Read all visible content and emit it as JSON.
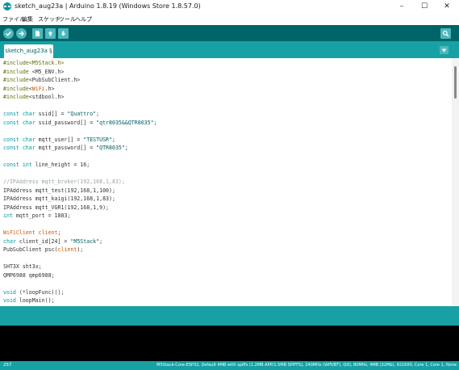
{
  "window": {
    "title": "sketch_aug23a | Arduino 1.8.19 (Windows Store 1.8.57.0)",
    "minimize": "–",
    "maximize": "☐",
    "close": "✕"
  },
  "menu": [
    "ファイル",
    "編集",
    "スケッチ",
    "ツール",
    "ヘルプ"
  ],
  "tab": {
    "label": "sketch_aug23a §"
  },
  "code": [
    [
      [
        "pre",
        "#include<M5Stack.h>"
      ]
    ],
    [
      [
        "pre",
        "#include "
      ],
      [
        "id",
        "<M5_ENV.h>"
      ]
    ],
    [
      [
        "pre",
        "#include"
      ],
      [
        "id",
        "<PubSubClient.h>"
      ]
    ],
    [
      [
        "pre",
        "#include"
      ],
      [
        "id",
        "<"
      ],
      [
        "cls",
        "WiFi"
      ],
      [
        "id",
        ".h>"
      ]
    ],
    [
      [
        "pre",
        "#include"
      ],
      [
        "id",
        "<stdbool.h>"
      ]
    ],
    [],
    [
      [
        "kw",
        "const char"
      ],
      [
        "id",
        " ssid[] = "
      ],
      [
        "str",
        "\"Quattro\""
      ],
      [
        "id",
        ";"
      ]
    ],
    [
      [
        "kw",
        "const char"
      ],
      [
        "id",
        " ssid_password[] = "
      ],
      [
        "str",
        "\"qtr8035&&QTR8035\""
      ],
      [
        "id",
        ";"
      ]
    ],
    [],
    [
      [
        "kw",
        "const char"
      ],
      [
        "id",
        " mqtt_user[] = "
      ],
      [
        "str",
        "\"TESTUSR\""
      ],
      [
        "id",
        ";"
      ]
    ],
    [
      [
        "kw",
        "const char"
      ],
      [
        "id",
        " mqtt_password[] = "
      ],
      [
        "str",
        "\"QTR8035\""
      ],
      [
        "id",
        ";"
      ]
    ],
    [],
    [
      [
        "kw",
        "const int"
      ],
      [
        "id",
        " line_height = 16;"
      ]
    ],
    [],
    [
      [
        "cm",
        "//IPAddress mqtt_broker(192,168,1,83);"
      ]
    ],
    [
      [
        "id",
        "IPAddress mqtt_test(192,168,1,100);"
      ]
    ],
    [
      [
        "id",
        "IPAddress mqtt_kaigi(192,168,1,83);"
      ]
    ],
    [
      [
        "id",
        "IPAddress mqtt_VGR1(192,168,1,9);"
      ]
    ],
    [
      [
        "kw",
        "int"
      ],
      [
        "id",
        " mqtt_port = 1883;"
      ]
    ],
    [],
    [
      [
        "cls",
        "WiFiClient client"
      ],
      [
        "id",
        ";"
      ]
    ],
    [
      [
        "kw",
        "char"
      ],
      [
        "id",
        " client_id[24] = "
      ],
      [
        "str",
        "\"M5Stack\""
      ],
      [
        "id",
        ";"
      ]
    ],
    [
      [
        "id",
        "PubSubClient psc("
      ],
      [
        "cls",
        "client"
      ],
      [
        "id",
        ");"
      ]
    ],
    [],
    [
      [
        "id",
        "SHT3X sht3x;"
      ]
    ],
    [
      [
        "id",
        "QMP6988 qmp6988;"
      ]
    ],
    [],
    [
      [
        "kw",
        "void"
      ],
      [
        "id",
        " (*loopFunc)();"
      ]
    ],
    [
      [
        "kw",
        "void"
      ],
      [
        "id",
        " loopMain();"
      ]
    ]
  ],
  "status": {
    "line_number": "257",
    "board": "M5Stack-Core-ESP32, Default 4MB with spiffs (1.2MB APP/1.5MB SPIFFS), 240MHz (WiFi/BT), QIO, 80MHz, 4MB (32Mb), 921600, Core 1, Core 1, None"
  },
  "colors": {
    "toolbar": "#006468",
    "tabbar": "#17a1a5",
    "button": "#4db7bb"
  }
}
